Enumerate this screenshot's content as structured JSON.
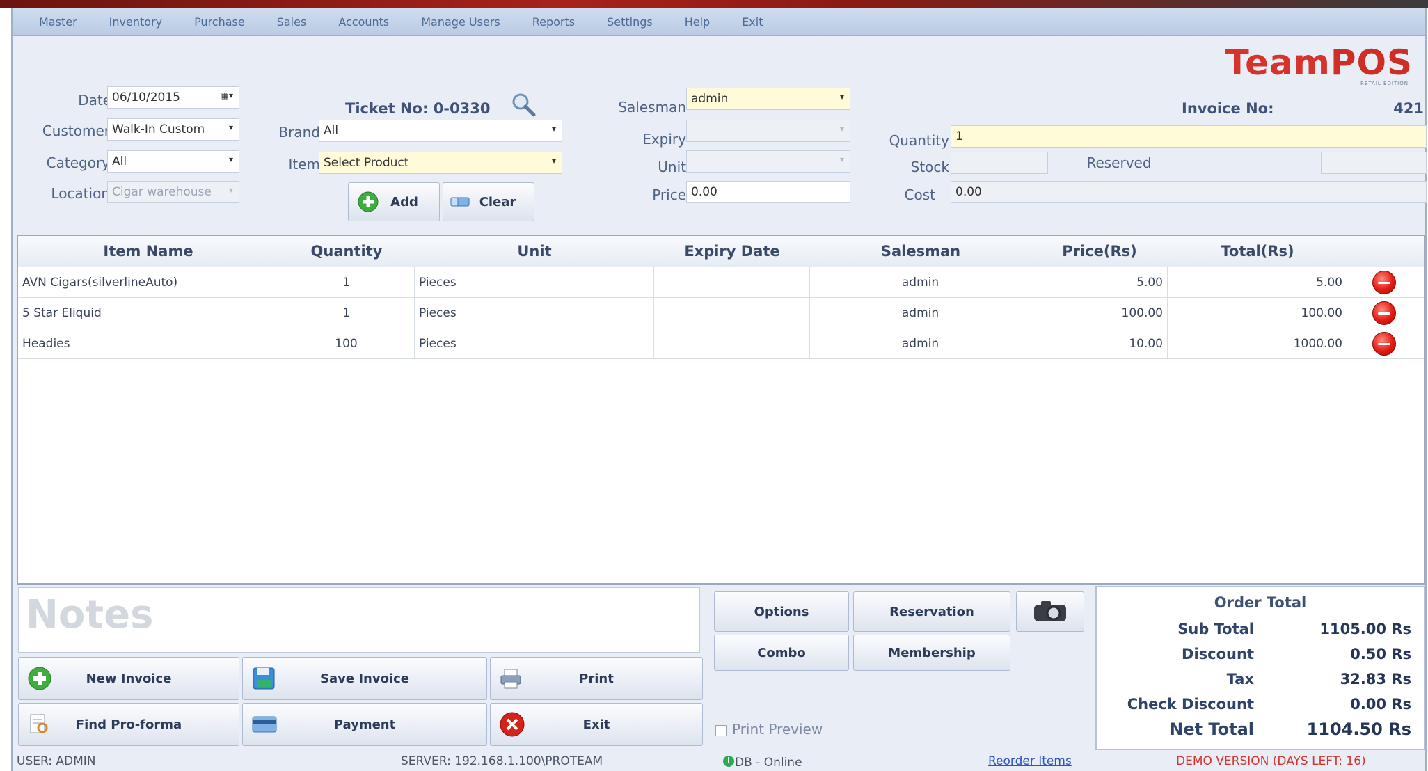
{
  "menu": [
    "Master",
    "Inventory",
    "Purchase",
    "Sales",
    "Accounts",
    "Manage Users",
    "Reports",
    "Settings",
    "Help",
    "Exit"
  ],
  "logo": {
    "text_main": "Team",
    "text_accent": "POS",
    "sub": "RETAIL EDITION"
  },
  "form": {
    "date_label": "Date",
    "date_value": "06/10/2015",
    "customer_label": "Customer",
    "customer_value": "Walk-In Custom",
    "category_label": "Category",
    "category_value": "All",
    "location_label": "Location",
    "location_value": "Cigar warehouse",
    "ticket_label": "Ticket No:",
    "ticket_value": "0-0330",
    "brand_label": "Brand",
    "brand_value": "All",
    "item_label": "Item",
    "item_value": "Select Product",
    "add_label": "Add",
    "clear_label": "Clear",
    "salesman_label": "Salesman",
    "salesman_value": "admin",
    "expiry_label": "Expiry",
    "expiry_value": "",
    "unit_label": "Unit",
    "unit_value": "",
    "price_label": "Price",
    "price_value": "0.00",
    "invoice_label": "Invoice No:",
    "invoice_value": "421",
    "quantity_label": "Quantity",
    "quantity_value": "1",
    "stock_label": "Stock",
    "stock_value": "",
    "reserved_label": "Reserved",
    "reserved_value": "",
    "cost_label": "Cost",
    "cost_value": "0.00"
  },
  "grid": {
    "columns": [
      "Item Name",
      "Quantity",
      "Unit",
      "Expiry Date",
      "Salesman",
      "Price(Rs)",
      "Total(Rs)"
    ],
    "rows": [
      {
        "name": "AVN Cigars(silverlineAuto)",
        "qty": "1",
        "unit": "Pieces",
        "expiry": "",
        "salesman": "admin",
        "price": "5.00",
        "total": "5.00"
      },
      {
        "name": "5 Star Eliquid",
        "qty": "1",
        "unit": "Pieces",
        "expiry": "",
        "salesman": "admin",
        "price": "100.00",
        "total": "100.00"
      },
      {
        "name": "Headies",
        "qty": "100",
        "unit": "Pieces",
        "expiry": "",
        "salesman": "admin",
        "price": "10.00",
        "total": "1000.00"
      }
    ]
  },
  "notes_placeholder": "Notes",
  "buttons": {
    "new_invoice": "New Invoice",
    "save_invoice": "Save Invoice",
    "print": "Print",
    "find_proforma": "Find Pro-forma",
    "payment": "Payment",
    "exit": "Exit",
    "options": "Options",
    "reservation": "Reservation",
    "combo": "Combo",
    "membership": "Membership",
    "print_preview": "Print Preview"
  },
  "order_total": {
    "title": "Order Total",
    "sub_total_label": "Sub Total",
    "sub_total": "1105.00 Rs",
    "discount_label": "Discount",
    "discount": "0.50 Rs",
    "tax_label": "Tax",
    "tax": "32.83 Rs",
    "check_discount_label": "Check Discount",
    "check_discount": "0.00 Rs",
    "net_total_label": "Net Total",
    "net_total": "1104.50 Rs"
  },
  "status": {
    "user": "USER: ADMIN",
    "server": "SERVER: 192.168.1.100\\PROTEAM",
    "db": "DB - Online",
    "reorder": "Reorder Items",
    "demo": "DEMO VERSION (DAYS LEFT: 16)"
  },
  "colors": {
    "accent_red": "#d4342c",
    "panel_bg": "#e9eef6",
    "highlight_yellow": "#fffbd8"
  }
}
